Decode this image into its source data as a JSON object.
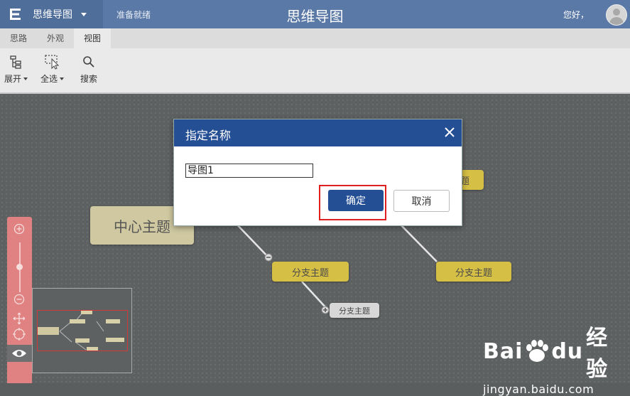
{
  "app": {
    "menu_title": "思维导图",
    "status": "准备就绪",
    "center_title": "思维导图",
    "greeting": "您好，"
  },
  "tabs": [
    {
      "label": "思路",
      "active": false
    },
    {
      "label": "外观",
      "active": false
    },
    {
      "label": "视图",
      "active": true
    }
  ],
  "toolbar": {
    "expand_label": "展开",
    "select_all_label": "全选",
    "search_label": "搜索"
  },
  "mindmap": {
    "central": "中心主题",
    "branch_left": "分支主题",
    "branch_right": "分支主题",
    "branch_top_partial": "题",
    "sub": "分支主题"
  },
  "dialog": {
    "title": "指定名称",
    "input_value": "导图1",
    "ok_label": "确定",
    "cancel_label": "取消"
  },
  "watermark": {
    "brand_left": "Bai",
    "brand_right": "du",
    "brand_cn": "经验",
    "url": "jingyan.baidu.com"
  },
  "colors": {
    "topbar": "#5a79a6",
    "dialog_header": "#254f95",
    "branch": "#d6bf45",
    "central": "#cfc8a0",
    "highlight": "#e02020",
    "zoom_panel": "#e08282"
  }
}
